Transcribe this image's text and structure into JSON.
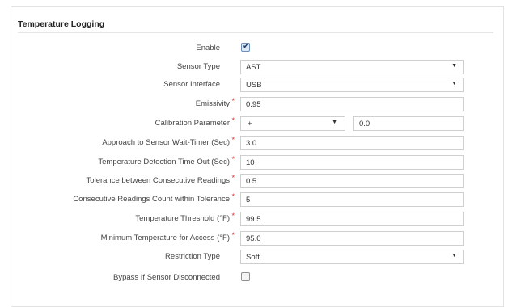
{
  "section": {
    "title": "Temperature Logging"
  },
  "rows": {
    "enable": {
      "label": "Enable",
      "checked": true
    },
    "sensor_type": {
      "label": "Sensor Type",
      "value": "AST"
    },
    "sensor_interface": {
      "label": "Sensor Interface",
      "value": "USB"
    },
    "emissivity": {
      "label": "Emissivity",
      "value": "0.95",
      "required": "*"
    },
    "calibration": {
      "label": "Calibration Parameter",
      "sign": "+",
      "value": "0.0",
      "required": "*"
    },
    "wait_timer": {
      "label": "Approach to Sensor Wait-Timer (Sec)",
      "value": "3.0",
      "required": "*"
    },
    "detection_timeout": {
      "label": "Temperature Detection Time Out (Sec)",
      "value": "10",
      "required": "*"
    },
    "tolerance": {
      "label": "Tolerance between Consecutive Readings",
      "value": "0.5",
      "required": "*"
    },
    "readings_count": {
      "label": "Consecutive Readings Count within Tolerance",
      "value": "5",
      "required": "*"
    },
    "threshold": {
      "label": "Temperature Threshold (°F)",
      "value": "99.5",
      "required": "*"
    },
    "min_temp": {
      "label": "Minimum Temperature for Access (°F)",
      "value": "95.0",
      "required": "*"
    },
    "restriction_type": {
      "label": "Restriction Type",
      "value": "Soft"
    },
    "bypass": {
      "label": "Bypass If Sensor Disconnected",
      "checked": false
    }
  },
  "icons": {
    "caret": "▼",
    "check": "✔"
  },
  "colors": {
    "required": "#d9302c",
    "border": "#cfcfcf"
  }
}
